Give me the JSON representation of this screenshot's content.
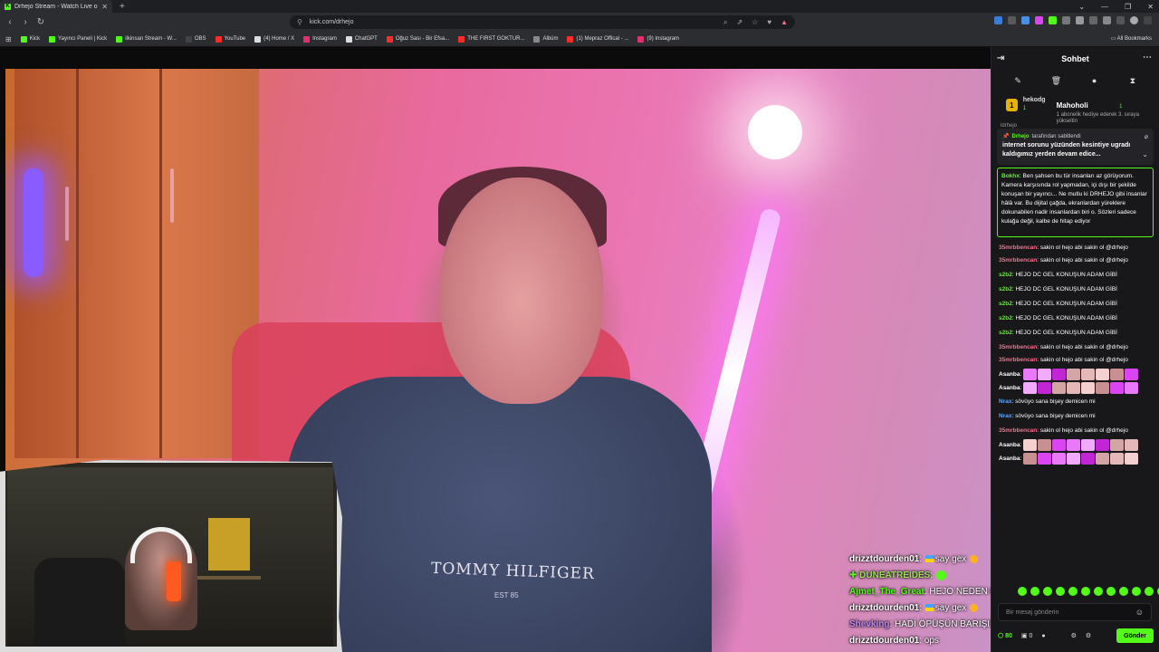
{
  "browser": {
    "tab_title": "Drhejo Stream - Watch Live o",
    "url": "kick.com/drhejo",
    "bookmarks": [
      {
        "label": "Kick",
        "color": "#53fc18"
      },
      {
        "label": "Yayıncı Paneli | Kick",
        "color": "#53fc18"
      },
      {
        "label": "ilkinsan Stream - W...",
        "color": "#53fc18"
      },
      {
        "label": "OBS",
        "color": "#444444"
      },
      {
        "label": "YouTube",
        "color": "#ff2a2a"
      },
      {
        "label": "(4) Home / X",
        "color": "#dddddd"
      },
      {
        "label": "Instagram",
        "color": "#e1306c"
      },
      {
        "label": "ChatGPT",
        "color": "#dddddd"
      },
      {
        "label": "Oğuz Sası - Bir Efsa...",
        "color": "#ff2a2a"
      },
      {
        "label": "THE FIRST GOKTUR...",
        "color": "#ff2a2a"
      },
      {
        "label": "Albüm",
        "color": "#888888"
      },
      {
        "label": "(1) Mepraz Offical - ...",
        "color": "#ff2a2a"
      },
      {
        "label": "(9) Instagram",
        "color": "#e1306c"
      }
    ],
    "all_bookmarks": "All Bookmarks"
  },
  "stream": {
    "shirt_brand": "TOMMY HILFIGER",
    "shirt_sub": "EST 85"
  },
  "overlay_chat": [
    {
      "user": "drizztdourden01",
      "color": "#ffffff",
      "text": "say  gex"
    },
    {
      "user": "DUNEATREIDES",
      "color": "#9adf56",
      "text": ""
    },
    {
      "user": "Ajmet_The_Great",
      "color": "#53fc18",
      "text": "HEJO NEDEN KAÇTIN?"
    },
    {
      "user": "drizztdourden01",
      "color": "#ffffff",
      "text": "say  gex"
    },
    {
      "user": "Shevking",
      "color": "#c084fc",
      "text": "HADİ ÖPÜŞÜN BARIŞIN"
    },
    {
      "user": "drizztdourden01",
      "color": "#ffffff",
      "text": "ops"
    }
  ],
  "chat": {
    "title": "Sohbet",
    "top_gifter": {
      "name": "hekodg",
      "count": "1"
    },
    "gift": {
      "user": "Mahoholi",
      "count": "1",
      "line": "1 abonelik hediye ederek 3. sıraya yükseltin"
    },
    "pinned": {
      "by": "Drhejo",
      "suffix": "tarafından sabitlendi",
      "text": "internet sorunu yüzünden kesintiye ugradı kaldıgımız yerden devam edice..."
    },
    "featured_cut": "ldrhejo",
    "featured": {
      "user": "Bokhx",
      "text": "Ben şahsen bu tür insanları az görüyorum. Kamera karşısında rol yapmadan, içi dışı bir şekilde konuşan bir yayıncı... Ne mutlu ki DRHEJO gibi insanlar hâlâ var. Bu dijital çağda, ekranlardan yüreklere dokunabilen nadir insanlardan biri o. Sözleri sadece kulağa değil, kalbe de hitap ediyor"
    },
    "messages": [
      {
        "user": "35mrbbencan",
        "cls": "u-pink",
        "text": "sakin ol hejo abi sakin ol @drhejo",
        "wrap": true
      },
      {
        "user": "35mrbbencan",
        "cls": "u-pink",
        "text": "sakin ol hejo abi sakin ol @drhejo",
        "wrap": true
      },
      {
        "user": "s2b2",
        "cls": "u-green",
        "text": "HEJO DC GEL KONUŞUN ADAM GİBİ"
      },
      {
        "user": "s2b2",
        "cls": "u-green",
        "text": "HEJO DC GEL KONUŞUN ADAM GİBİ"
      },
      {
        "user": "s2b2",
        "cls": "u-green",
        "text": "HEJO DC GEL KONUŞUN ADAM GİBİ"
      },
      {
        "user": "s2b2",
        "cls": "u-green",
        "text": "HEJO DC GEL KONUŞUN ADAM GİBİ"
      },
      {
        "user": "s2b2",
        "cls": "u-green",
        "text": "HEJO DC GEL KONUŞUN ADAM GİBİ"
      },
      {
        "user": "35mrbbencan",
        "cls": "u-pink",
        "text": "sakin ol hejo abi sakin ol @drhejo",
        "wrap": true
      },
      {
        "user": "35mrbbencan",
        "cls": "u-pink",
        "text": "sakin ol hejo abi sakin ol @drhejo",
        "wrap": true
      },
      {
        "user": "Asanba",
        "cls": "u-white",
        "text": "",
        "emotes": true
      },
      {
        "user": "Asanba",
        "cls": "u-white",
        "text": "",
        "emotes": true
      },
      {
        "user": "Nrax",
        "cls": "u-blue",
        "text": "sövüyo sana bişey demicen mi"
      },
      {
        "user": "Nrax",
        "cls": "u-blue",
        "text": "sövüyo sana bişey demicen mi"
      },
      {
        "user": "35mrbbencan",
        "cls": "u-pink",
        "text": "sakin ol hejo abi sakin ol @drhejo",
        "wrap": true
      },
      {
        "user": "Asanba",
        "cls": "u-white",
        "text": "",
        "emotes": true
      },
      {
        "user": "Asanba",
        "cls": "u-white",
        "text": "",
        "emotes": true
      }
    ],
    "input_placeholder": "Bir mesaj gönderin",
    "points": "80",
    "count": "0",
    "send_label": "Gönder"
  }
}
